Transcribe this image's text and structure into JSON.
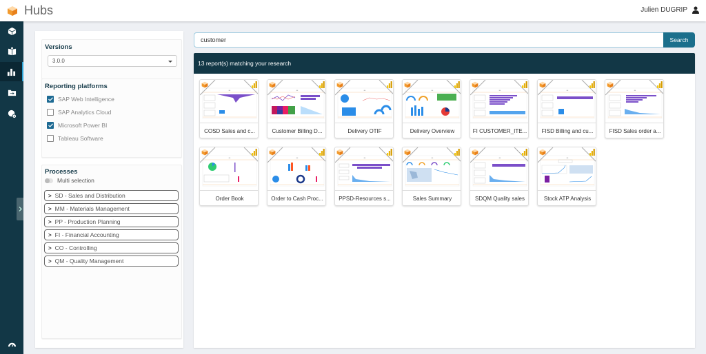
{
  "header": {
    "app_title": "Hubs",
    "user_name": "Julien DUGRIP",
    "logo_icon": "cube-logo-icon",
    "user_icon": "person-icon"
  },
  "sidebar": {
    "items": [
      {
        "icon": "cube-icon",
        "active": false
      },
      {
        "icon": "book-icon",
        "active": false
      },
      {
        "icon": "bar-chart-icon",
        "active": true
      },
      {
        "icon": "folder-arrow-icon",
        "active": false
      },
      {
        "icon": "cookie-settings-icon",
        "active": false
      }
    ],
    "bottom_icon": "speedometer-icon",
    "collapse_icon": "chevron-right-icon"
  },
  "filters": {
    "versions": {
      "title": "Versions",
      "selected": "3.0.0"
    },
    "platforms": {
      "title": "Reporting platforms",
      "items": [
        {
          "label": "SAP Web Intelligence",
          "checked": true
        },
        {
          "label": "SAP Analytics Cloud",
          "checked": false
        },
        {
          "label": "Microsoft Power BI",
          "checked": true
        },
        {
          "label": "Tableau Software",
          "checked": false
        }
      ]
    },
    "processes": {
      "title": "Processes",
      "multi_selection_label": "Multi selection",
      "items": [
        "SD - Sales and Distribution",
        "MM - Materials Management",
        "PP - Production Planning",
        "FI - Financial Accounting",
        "CO - Controlling",
        "QM - Quality Management"
      ]
    }
  },
  "search": {
    "value": "customer",
    "button_label": "Search"
  },
  "results": {
    "header": "13 report(s) matching your research",
    "accent_colors": {
      "purple": "#7b4fc9",
      "blue": "#2b8de8",
      "orange": "#f0a12a",
      "powerbi": "#f2c811"
    },
    "reports": [
      {
        "title": "COSD Sales and c...",
        "thumb": "kpi-funnel"
      },
      {
        "title": "Customer Billing D...",
        "thumb": "lines-treemap"
      },
      {
        "title": "Delivery OTIF",
        "thumb": "pie-gauges"
      },
      {
        "title": "Delivery Overview",
        "thumb": "gauges-bars"
      },
      {
        "title": "FI CUSTOMER_ITE...",
        "thumb": "kpi-hbars"
      },
      {
        "title": "FISD Billing and cu...",
        "thumb": "kpi-bigbar"
      },
      {
        "title": "FISD Sales order a...",
        "thumb": "kpi-hbars-area"
      },
      {
        "title": "Order Book",
        "thumb": "pie-table"
      },
      {
        "title": "Order to Cash Proc...",
        "thumb": "bars-donut"
      },
      {
        "title": "PPSD-Resources s...",
        "thumb": "gantt-area"
      },
      {
        "title": "Sales Summary",
        "thumb": "map-gauges"
      },
      {
        "title": "SDQM Quality sales",
        "thumb": "kpi-bigbar-area"
      },
      {
        "title": "Stock ATP Analysis",
        "thumb": "map-purple"
      }
    ]
  }
}
